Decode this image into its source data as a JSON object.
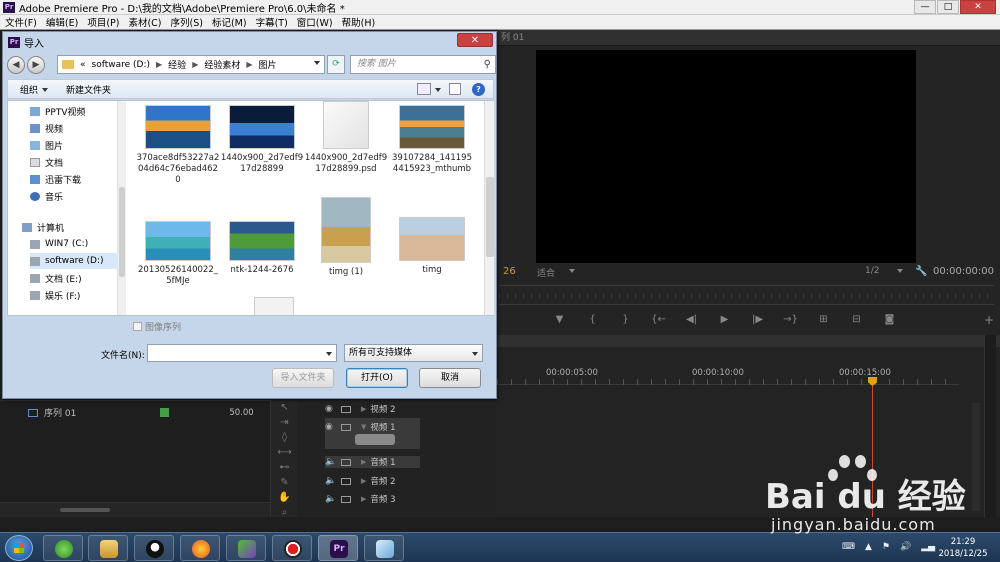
{
  "app": {
    "title": "Adobe Premiere Pro - D:\\我的文档\\Adobe\\Premiere Pro\\6.0\\未命名 *",
    "logo": "Pr",
    "window_controls": [
      "—",
      "□",
      "✕"
    ]
  },
  "menu": [
    "文件(F)",
    "编辑(E)",
    "项目(P)",
    "素材(C)",
    "序列(S)",
    "标记(M)",
    "字幕(T)",
    "窗口(W)",
    "帮助(H)"
  ],
  "monitor": {
    "tab": "列 01",
    "timecode_left": "26",
    "fit": "适合",
    "resolution": "1/2",
    "timecode_right": "00:00:00:00",
    "transport_icons": [
      "marker-icon",
      "in-point-icon",
      "out-point-icon",
      "go-to-in-icon",
      "step-back-icon",
      "play-icon",
      "step-forward-icon",
      "go-to-out-icon",
      "insert-icon",
      "overwrite-icon",
      "export-frame-icon"
    ]
  },
  "timeline": {
    "ticks": [
      "00:00:05:00",
      "00:00:10:00",
      "00:00:15:00"
    ],
    "tracks": [
      {
        "name": "视频 2",
        "type": "video"
      },
      {
        "name": "视频 1",
        "type": "video"
      },
      {
        "name": "音频 1",
        "type": "audio"
      },
      {
        "name": "音频 2",
        "type": "audio"
      },
      {
        "name": "音频 3",
        "type": "audio"
      }
    ]
  },
  "project": {
    "sequence_name": "序列 01",
    "fps": "50.00",
    "label_color": "#43a047"
  },
  "dialog": {
    "title": "导入",
    "close": "✕",
    "path": [
      "«",
      "software (D:)",
      "经验",
      "经验素材",
      "图片"
    ],
    "search_placeholder": "搜索 图片",
    "toolbar": {
      "organize": "组织",
      "new_folder": "新建文件夹"
    },
    "nav_items": [
      "PPTV视频",
      "视频",
      "图片",
      "文档",
      "迅雷下载",
      "音乐",
      "计算机",
      "WIN7 (C:)",
      "software (D:)",
      "文档 (E:)",
      "娱乐 (F:)"
    ],
    "files": [
      {
        "name": "370ace8df53227a204d64c76ebad4620",
        "kind": "autumn-lake-photo"
      },
      {
        "name": "1440x900_2d7edf917d28899",
        "kind": "blue-sea-photo"
      },
      {
        "name": "1440x900_2d7edf917d28899.psd",
        "kind": "blank-file"
      },
      {
        "name": "39107284_1411954415923_mthumb",
        "kind": "sunset-coast-photo"
      },
      {
        "name": "20130526140022_5fMJe",
        "kind": "tropical-island-photo"
      },
      {
        "name": "ntk-1244-2676",
        "kind": "green-coast-photo"
      },
      {
        "name": "timg (1)",
        "kind": "girl-on-beach-photo"
      },
      {
        "name": "timg",
        "kind": "girl-on-sand-photo"
      }
    ],
    "image_sequence_label": "图像序列",
    "filename_label": "文件名(N):",
    "filename_value": "",
    "filetype_value": "所有可支持媒体",
    "buttons": {
      "import_folder": "导入文件夹",
      "open": "打开(O)",
      "cancel": "取消"
    }
  },
  "taskbar": {
    "time": "21:29",
    "date": "2018/12/25"
  },
  "watermark": {
    "brand": "Bai du 经验",
    "url": "jingyan.baidu.com"
  }
}
